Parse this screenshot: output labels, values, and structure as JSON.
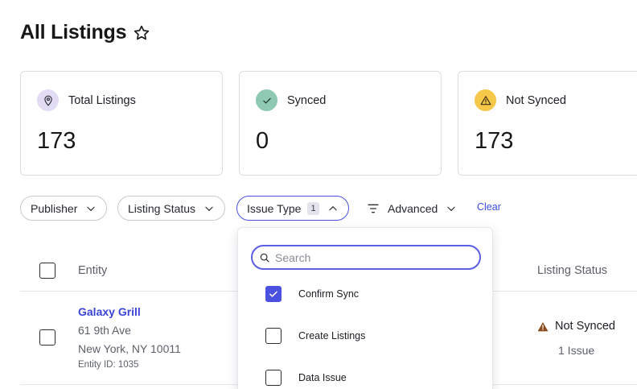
{
  "page": {
    "title": "All Listings"
  },
  "cards": [
    {
      "label": "Total Listings",
      "value": "173",
      "icon": "location-pin-icon",
      "icon_bg": "#e1dcf3"
    },
    {
      "label": "Synced",
      "value": "0",
      "icon": "check-icon",
      "icon_bg": "#8fc9b2"
    },
    {
      "label": "Not Synced",
      "value": "173",
      "icon": "warning-icon",
      "icon_bg": "#f5c84a"
    }
  ],
  "filters": {
    "publisher": "Publisher",
    "listing_status": "Listing Status",
    "issue_type": "Issue Type",
    "issue_type_count": "1",
    "advanced": "Advanced",
    "clear": "Clear"
  },
  "dropdown": {
    "search_placeholder": "Search",
    "options": [
      {
        "label": "Confirm Sync",
        "checked": true
      },
      {
        "label": "Create Listings",
        "checked": false
      },
      {
        "label": "Data Issue",
        "checked": false
      }
    ]
  },
  "table": {
    "columns": [
      "Entity",
      "Listing Status"
    ],
    "rows": [
      {
        "name": "Galaxy Grill",
        "address_line1": "61 9th Ave",
        "address_line2": "New York, NY 10011",
        "entity_id": "Entity ID: 1035",
        "status": "Not Synced",
        "issues": "1 Issue"
      }
    ]
  },
  "colors": {
    "accent": "#4a50e0",
    "link": "#3a44d6",
    "warning": "#8a4b1a"
  }
}
